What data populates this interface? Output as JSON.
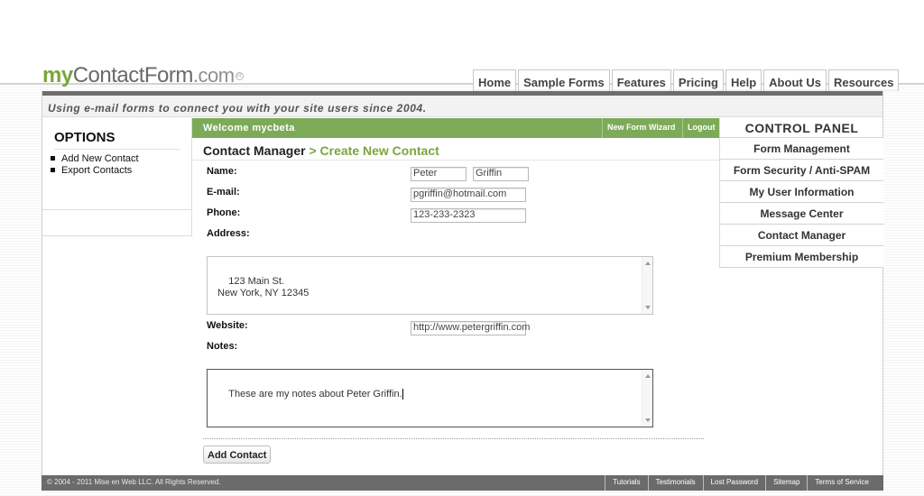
{
  "brand": {
    "my": "my",
    "contactform": "ContactForm",
    "com": ".com",
    "reg": "R"
  },
  "nav": {
    "items": [
      "Home",
      "Sample Forms",
      "Features",
      "Pricing",
      "Help",
      "About Us",
      "Resources"
    ]
  },
  "tagline": "Using e-mail forms to connect you with your site users since 2004.",
  "options": {
    "title": "OPTIONS",
    "items": [
      "Add New Contact",
      "Export Contacts"
    ]
  },
  "welcome": {
    "text": "Welcome mycbeta",
    "new_form_wizard": "New Form Wizard",
    "logout": "Logout"
  },
  "heading": {
    "main": "Contact Manager",
    "sub": " > Create New Contact"
  },
  "form": {
    "name_label": "Name:",
    "first_name": "Peter",
    "last_name": "Griffin",
    "email_label": "E-mail:",
    "email": "pgriffin@hotmail.com",
    "phone_label": "Phone:",
    "phone": "123-233-2323",
    "address_label": "Address:",
    "address": "123 Main St.\nNew York, NY 12345",
    "website_label": "Website:",
    "website": "http://www.petergriffin.com",
    "notes_label": "Notes:",
    "notes": "These are my notes about Peter Griffin.",
    "add_button": "Add Contact"
  },
  "control_panel": {
    "title": "CONTROL PANEL",
    "items": [
      "Form Management",
      "Form Security / Anti-SPAM",
      "My User Information",
      "Message Center",
      "Contact Manager",
      "Premium Membership"
    ]
  },
  "footer": {
    "copyright": "© 2004 - 2011 Mise en Web LLC. All Rights Reserved.",
    "links": [
      "Tutorials",
      "Testimonials",
      "Lost Password",
      "Sitemap",
      "Terms of Service"
    ]
  }
}
